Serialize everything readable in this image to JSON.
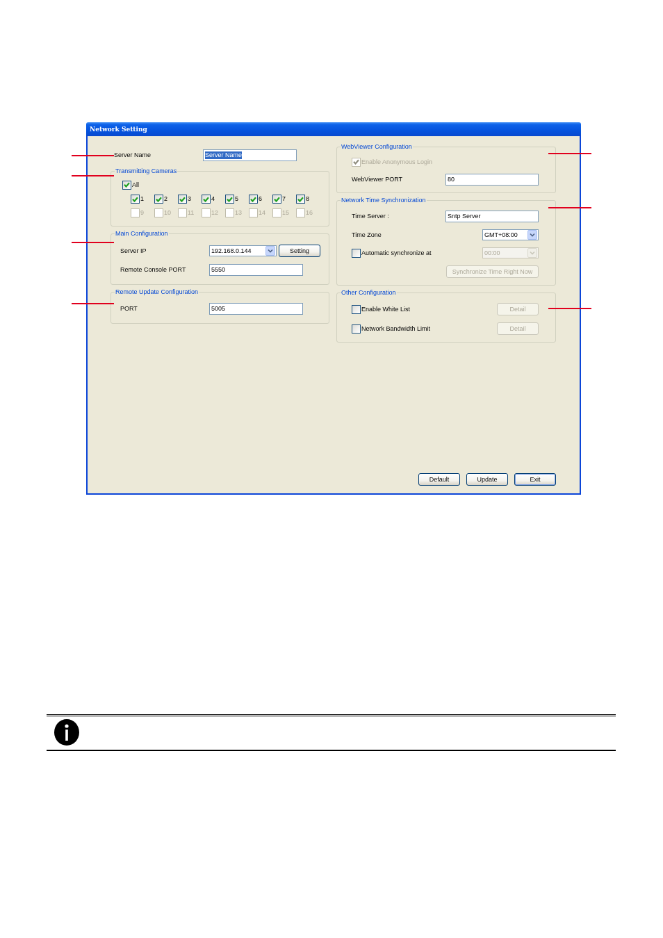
{
  "window": {
    "title": "Network Setting"
  },
  "left_column": [
    {
      "kind": "field",
      "label": "Server Name",
      "value": "Server Name",
      "text_selected": true
    },
    {
      "kind": "group",
      "title": "Transmitting Cameras",
      "rows": [
        {
          "kind": "checkbox",
          "label": "All",
          "checked": true,
          "disabled": false
        },
        {
          "kind": "checkbox_grid",
          "items": [
            {
              "label": "1",
              "checked": true,
              "disabled": false
            },
            {
              "label": "2",
              "checked": true,
              "disabled": false
            },
            {
              "label": "3",
              "checked": true,
              "disabled": false
            },
            {
              "label": "4",
              "checked": true,
              "disabled": false
            },
            {
              "label": "5",
              "checked": true,
              "disabled": false
            },
            {
              "label": "6",
              "checked": true,
              "disabled": false
            },
            {
              "label": "7",
              "checked": true,
              "disabled": false
            },
            {
              "label": "8",
              "checked": true,
              "disabled": false
            },
            {
              "label": "9",
              "checked": false,
              "disabled": true
            },
            {
              "label": "10",
              "checked": false,
              "disabled": true
            },
            {
              "label": "11",
              "checked": false,
              "disabled": true
            },
            {
              "label": "12",
              "checked": false,
              "disabled": true
            },
            {
              "label": "13",
              "checked": false,
              "disabled": true
            },
            {
              "label": "14",
              "checked": false,
              "disabled": true
            },
            {
              "label": "15",
              "checked": false,
              "disabled": true
            },
            {
              "label": "16",
              "checked": false,
              "disabled": true
            }
          ]
        }
      ]
    },
    {
      "kind": "group",
      "title": "Main Configuration",
      "rows": [
        {
          "kind": "select",
          "label": "Server IP",
          "value": "192.168.0.144",
          "disabled": false,
          "button": {
            "label": "Setting",
            "disabled": false
          }
        },
        {
          "kind": "field",
          "label": "Remote Console PORT",
          "value": "5550"
        }
      ]
    },
    {
      "kind": "group",
      "title": "Remote Update Configuration",
      "rows": [
        {
          "kind": "field",
          "label": "PORT",
          "value": "5005"
        }
      ]
    }
  ],
  "right_column": [
    {
      "kind": "group",
      "title": "WebViewer Configuration",
      "rows": [
        {
          "kind": "checkbox",
          "label": "Enable Anonymous Login",
          "checked": true,
          "disabled": true
        },
        {
          "kind": "field",
          "label": "WebViewer PORT",
          "value": "80"
        }
      ]
    },
    {
      "kind": "group",
      "title": "Network Time Synchronization",
      "rows": [
        {
          "kind": "field",
          "label": "Time Server :",
          "value": "Sntp Server"
        },
        {
          "kind": "select",
          "label": "Time Zone",
          "value": "GMT+08:00",
          "disabled": false
        },
        {
          "kind": "checkbox",
          "label": "Automatic synchronize at",
          "checked": false,
          "disabled": false,
          "select": {
            "value": "00:00",
            "disabled": true
          }
        },
        {
          "kind": "button",
          "label": "Synchronize Time Right Now",
          "disabled": true
        }
      ]
    },
    {
      "kind": "group",
      "title": "Other Configuration",
      "rows": [
        {
          "kind": "checkbox",
          "label": "Enable White List",
          "checked": false,
          "disabled": false,
          "button": {
            "label": "Detail",
            "disabled": true
          }
        },
        {
          "kind": "checkbox",
          "label": "Network Bandwidth Limit",
          "checked": false,
          "disabled": false,
          "button": {
            "label": "Detail",
            "disabled": true
          }
        }
      ]
    }
  ],
  "buttons": [
    {
      "label": "Default",
      "default": false
    },
    {
      "label": "Update",
      "default": false
    },
    {
      "label": "Exit",
      "default": true
    }
  ]
}
